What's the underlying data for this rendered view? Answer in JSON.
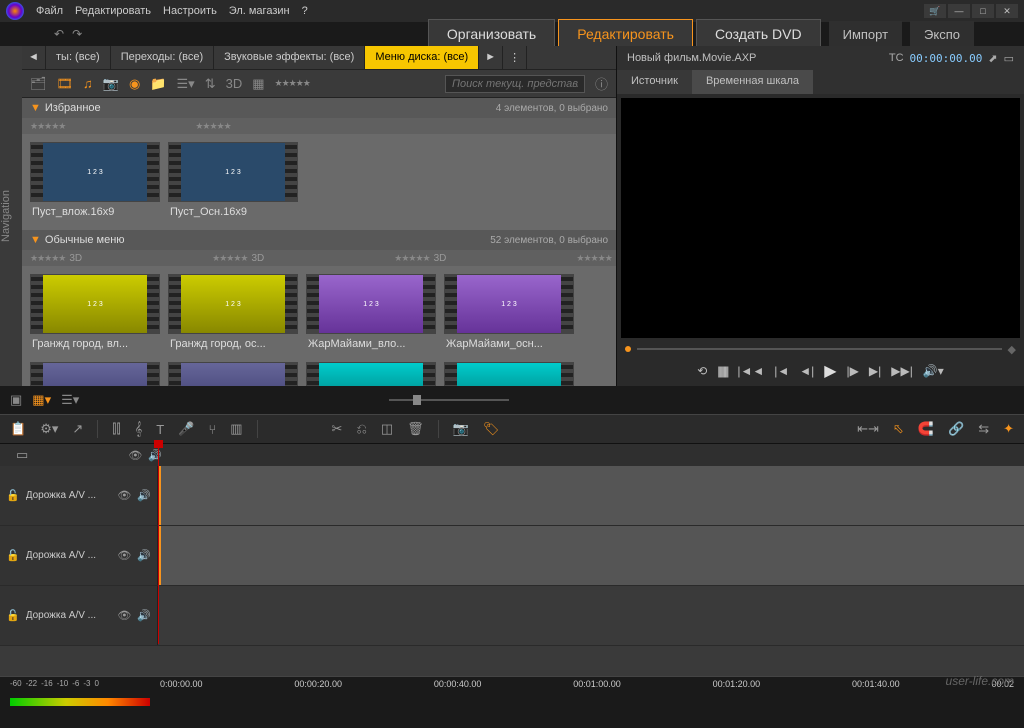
{
  "menubar": {
    "file": "Файл",
    "edit": "Редактировать",
    "setup": "Настроить",
    "estore": "Эл. магазин"
  },
  "main_tabs": {
    "organize": "Организовать",
    "edit": "Редактировать",
    "dvd": "Создать DVD"
  },
  "top_buttons": {
    "import": "Импорт",
    "export": "Экспо"
  },
  "nav_label": "Navigation",
  "lib_tabs": {
    "prev": "◄",
    "types": "ты: (все)",
    "transitions": "Переходы: (все)",
    "sfx": "Звуковые эффекты: (все)",
    "disc_menu": "Меню диска: (все)",
    "next": "►"
  },
  "search_placeholder": "Поиск текущ. представл",
  "sections": {
    "fav": {
      "title": "Избранное",
      "count": "4 элементов, 0 выбрано",
      "items": [
        {
          "label": "Пуст_влож.16x9",
          "cls": ""
        },
        {
          "label": "Пуст_Осн.16x9",
          "cls": ""
        }
      ]
    },
    "normal": {
      "title": "Обычные меню",
      "count": "52 элементов, 0 выбрано",
      "items": [
        {
          "label": "Гранжд город, вл...",
          "cls": "yellow-thumb"
        },
        {
          "label": "Гранжд город, ос...",
          "cls": "yellow-thumb"
        },
        {
          "label": "ЖарМайами_вло...",
          "cls": "purple-thumb"
        },
        {
          "label": "ЖарМайами_осн...",
          "cls": "purple-thumb"
        }
      ],
      "row2": [
        {
          "label": "",
          "cls": "blue-thumb"
        },
        {
          "label": "",
          "cls": "blue-thumb"
        },
        {
          "label": "",
          "cls": "cyan-thumb"
        },
        {
          "label": "",
          "cls": "cyan-thumb"
        }
      ]
    }
  },
  "tag3d": "3D",
  "project": {
    "name": "Новый фильм.Movie.AXP",
    "tc_label": "TC",
    "tc": "00:00:00.00"
  },
  "src_tabs": {
    "source": "Источник",
    "timeline": "Временная шкала"
  },
  "tracks": {
    "t1": "Дорожка A/V ...",
    "t2": "Дорожка A/V ...",
    "t3": "Дорожка A/V ..."
  },
  "db": [
    "-60",
    "-22",
    "-16",
    "-10",
    "-6",
    "-3",
    "0"
  ],
  "times": [
    "0:00:00.00",
    "00:00:20.00",
    "00:00:40.00",
    "00:01:00.00",
    "00:01:20.00",
    "00:01:40.00",
    "00:02"
  ],
  "watermark": "user-life.com"
}
